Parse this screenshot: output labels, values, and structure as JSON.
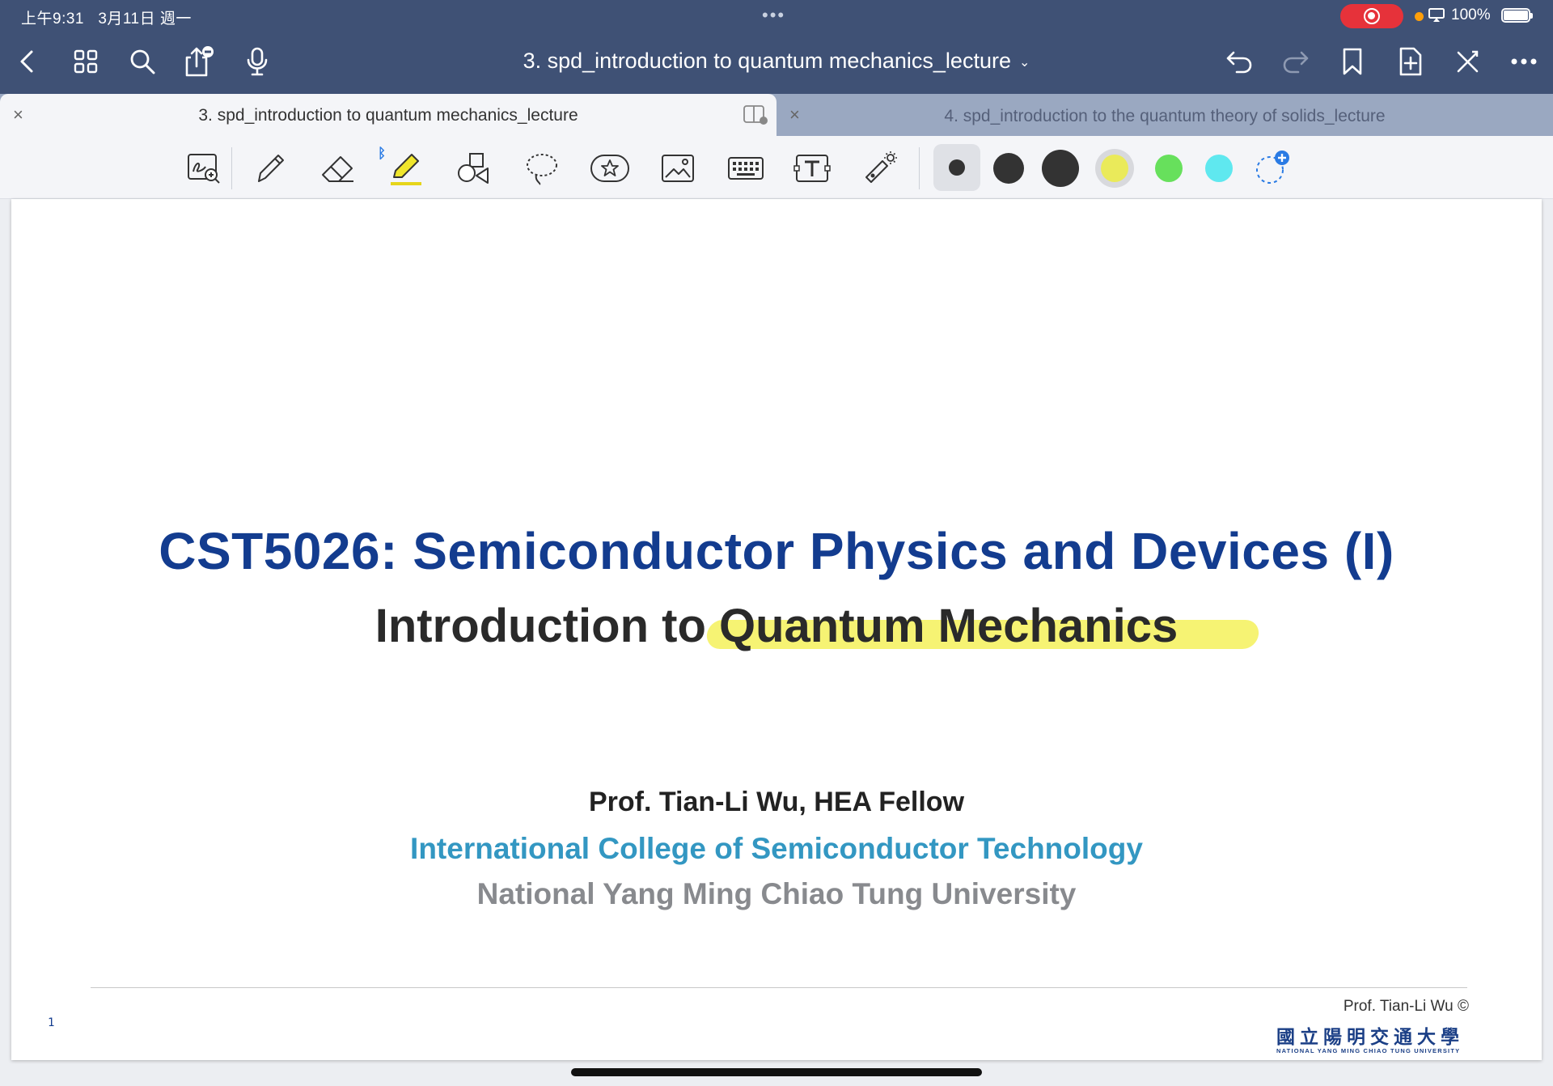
{
  "status": {
    "time": "上午9:31",
    "date": "3月11日 週一",
    "battery": "100%"
  },
  "nav": {
    "doc_title": "3. spd_introduction to quantum mechanics_lecture",
    "chevron": "⌄"
  },
  "tabs": [
    {
      "label": "3. spd_introduction to quantum mechanics_lecture",
      "active": true
    },
    {
      "label": "4. spd_introduction to the quantum theory of solids_lecture",
      "active": false
    }
  ],
  "toolbar": {
    "tools": [
      "zoom-window-tool",
      "pen-tool",
      "eraser-tool",
      "highlighter-tool",
      "shapes-tool",
      "lasso-tool",
      "stickers-tool",
      "image-tool",
      "keyboard-tool",
      "text-tool",
      "laser-pointer-tool"
    ],
    "colors": [
      "#333333",
      "#333333",
      "#333333",
      "#eaea5a",
      "#67e05c",
      "#5fe8ef"
    ]
  },
  "page": {
    "course_title": "CST5026: Semiconductor Physics and Devices (I)",
    "lecture_title": "Introduction to Quantum Mechanics",
    "professor": "Prof. Tian-Li Wu, HEA Fellow",
    "college": "International College of Semiconductor Technology",
    "university": "National Yang Ming Chiao Tung University",
    "page_number": "1",
    "copyright": "Prof. Tian-Li Wu ©",
    "logo_cn": "國立陽明交通大學",
    "logo_en": "NATIONAL YANG MING CHIAO TUNG UNIVERSITY"
  }
}
